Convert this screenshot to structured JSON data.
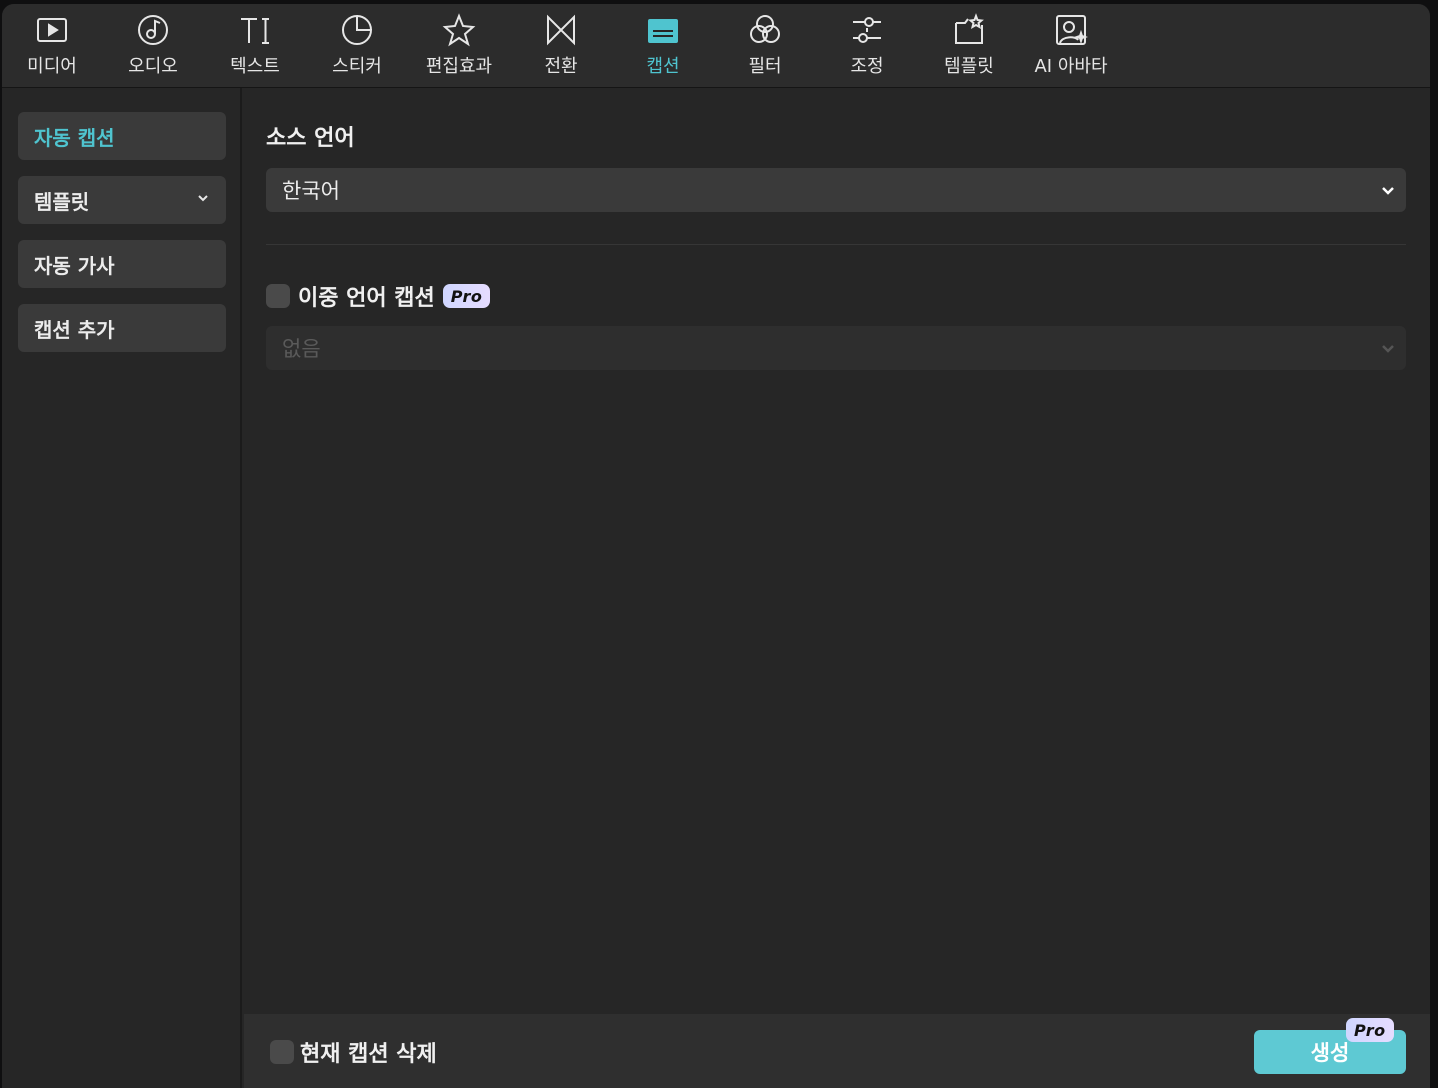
{
  "toolbar": {
    "items": [
      {
        "label": "미디어",
        "icon": "media-icon"
      },
      {
        "label": "오디오",
        "icon": "audio-icon"
      },
      {
        "label": "텍스트",
        "icon": "text-icon"
      },
      {
        "label": "스티커",
        "icon": "sticker-icon"
      },
      {
        "label": "편집효과",
        "icon": "effects-icon"
      },
      {
        "label": "전환",
        "icon": "transition-icon"
      },
      {
        "label": "캡션",
        "icon": "caption-icon",
        "active": true
      },
      {
        "label": "필터",
        "icon": "filter-icon"
      },
      {
        "label": "조정",
        "icon": "adjust-icon"
      },
      {
        "label": "템플릿",
        "icon": "template-icon"
      },
      {
        "label": "AI 아바타",
        "icon": "ai-avatar-icon"
      }
    ]
  },
  "sidebar": {
    "items": [
      {
        "label": "자동 캡션",
        "active": true
      },
      {
        "label": "템플릿",
        "has_dropdown": true
      },
      {
        "label": "자동 가사"
      },
      {
        "label": "캡션 추가"
      }
    ]
  },
  "main": {
    "source_language_title": "소스 언어",
    "source_language_value": "한국어",
    "bilingual_label": "이중 언어 캡션",
    "bilingual_checked": false,
    "bilingual_value": "없음",
    "pro_badge": "Pro"
  },
  "footer": {
    "delete_current_label": "현재 캡션 삭제",
    "delete_checked": false,
    "generate_label": "생성",
    "generate_pro_badge": "Pro"
  },
  "colors": {
    "accent": "#4fc4cf",
    "generate_button": "#5ec9d3",
    "panel_bg": "#262626",
    "toolbar_bg": "#2c2c2c",
    "control_bg": "#3a3a3a"
  }
}
